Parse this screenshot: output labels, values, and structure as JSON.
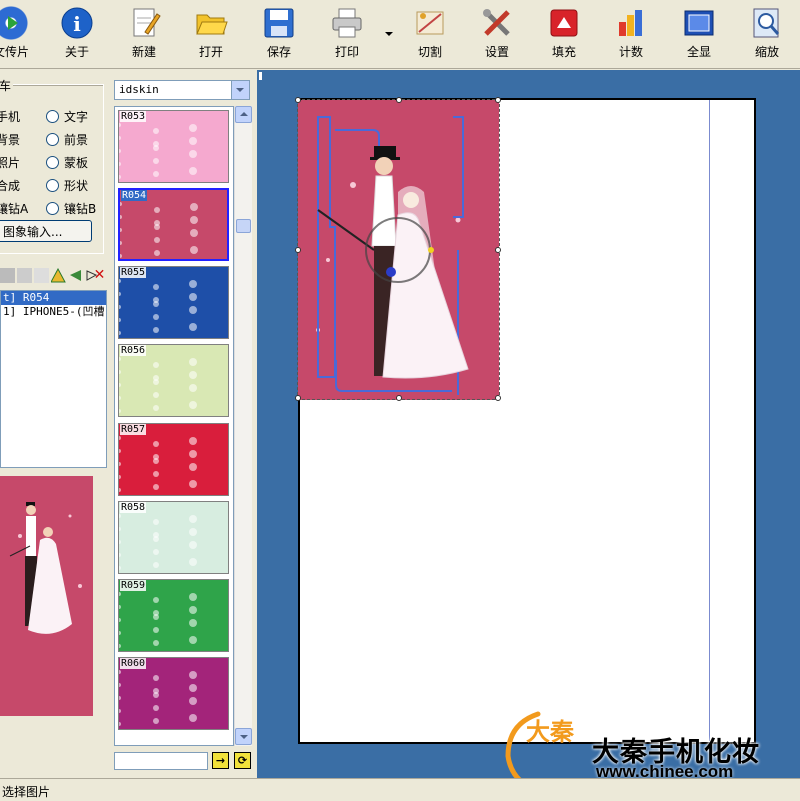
{
  "toolbar": {
    "items": [
      {
        "label": "文传片",
        "icon": "play-icon"
      },
      {
        "label": "关于",
        "icon": "info-icon"
      },
      {
        "label": "新建",
        "icon": "new-document-icon"
      },
      {
        "label": "打开",
        "icon": "folder-open-icon"
      },
      {
        "label": "保存",
        "icon": "save-disk-icon"
      },
      {
        "label": "打印",
        "icon": "printer-icon"
      },
      {
        "label": "切割",
        "icon": "cut-icon"
      },
      {
        "label": "设置",
        "icon": "tools-icon"
      },
      {
        "label": "填充",
        "icon": "fill-icon"
      },
      {
        "label": "计数",
        "icon": "count-chart-icon"
      },
      {
        "label": "全显",
        "icon": "fit-all-icon"
      },
      {
        "label": "缩放",
        "icon": "zoom-icon"
      }
    ]
  },
  "left_panel": {
    "group_title": "车",
    "radios": [
      "手机",
      "文字",
      "背景",
      "前景",
      "照片",
      "蒙板",
      "合成",
      "形状",
      "镶钻A",
      "镶钻B"
    ],
    "image_input_button": "图象输入...",
    "layers": [
      {
        "label": "t] R054",
        "selected": true
      },
      {
        "label": "1] IPHONE5-(凹槽",
        "selected": false
      }
    ]
  },
  "library": {
    "selected_library": "idskin",
    "thumbnails": [
      {
        "code": "R053",
        "color": "#F5A9CF"
      },
      {
        "code": "R054",
        "color": "#C6496A"
      },
      {
        "code": "R055",
        "color": "#1E4FA8"
      },
      {
        "code": "R056",
        "color": "#D9E8B4"
      },
      {
        "code": "R057",
        "color": "#D91E3C"
      },
      {
        "code": "R058",
        "color": "#D7EDE0"
      },
      {
        "code": "R059",
        "color": "#2FA44A"
      },
      {
        "code": "R060",
        "color": "#A3247A"
      }
    ]
  },
  "status": {
    "text": "选择图片"
  },
  "watermark": {
    "brand_name": "大秦手机化妆",
    "url": "www.chinee.com",
    "logo_chars": "大秦"
  },
  "colors": {
    "workarea_bg": "#3A6EA5",
    "artwork_bg": "#C6496A",
    "selection_highlight": "#316AC5"
  }
}
